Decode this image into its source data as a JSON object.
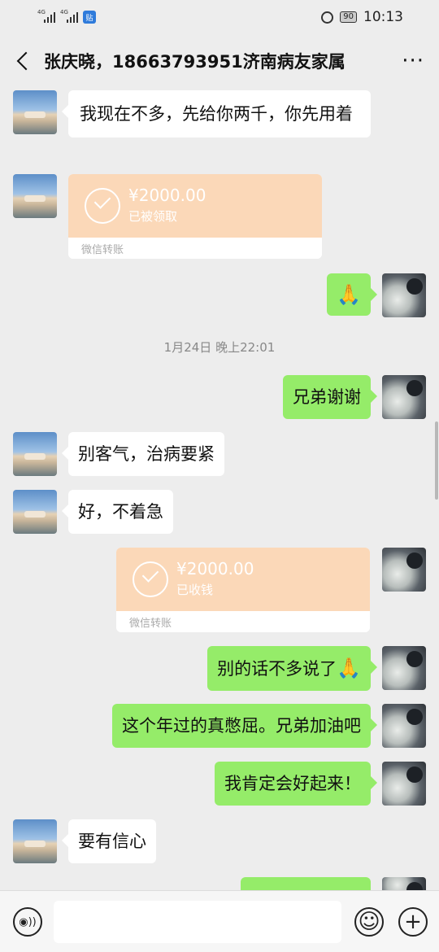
{
  "status_bar": {
    "signal1_label": "4G",
    "signal2_label": "4G",
    "notif_label": "贴",
    "battery": "90",
    "time": "10:13"
  },
  "header": {
    "title": "张庆晓，18663793951济南病友家属",
    "more_label": "···"
  },
  "messages": {
    "m1": "我现在不多，先给你两千，你先用着",
    "t1": {
      "amount": "¥2000.00",
      "status": "已被领取",
      "footer": "微信转账"
    },
    "m2": "🙏",
    "time_sep": "1月24日 晚上22:01",
    "m3": "兄弟谢谢",
    "m4": "别客气，治病要紧",
    "m5": "好，不着急",
    "t2": {
      "amount": "¥2000.00",
      "status": "已收钱",
      "footer": "微信转账"
    },
    "m6": "别的话不多说了",
    "m6_emoji": "🙏",
    "m7": "这个年过的真憋屈。兄弟加油吧",
    "m8": "我肯定会好起来！",
    "m9": "要有信心"
  },
  "input_bar": {
    "voice_icon": "voice-icon",
    "emoji_icon": "emoji-icon",
    "plus_icon": "plus-icon",
    "voice_glyph": "◉))",
    "emoji_glyph": "☺",
    "plus_glyph": "+",
    "placeholder": ""
  },
  "colors": {
    "background": "#ededed",
    "sent_bubble": "#95ec69",
    "received_bubble": "#ffffff",
    "transfer_card": "#fbd8b8"
  }
}
